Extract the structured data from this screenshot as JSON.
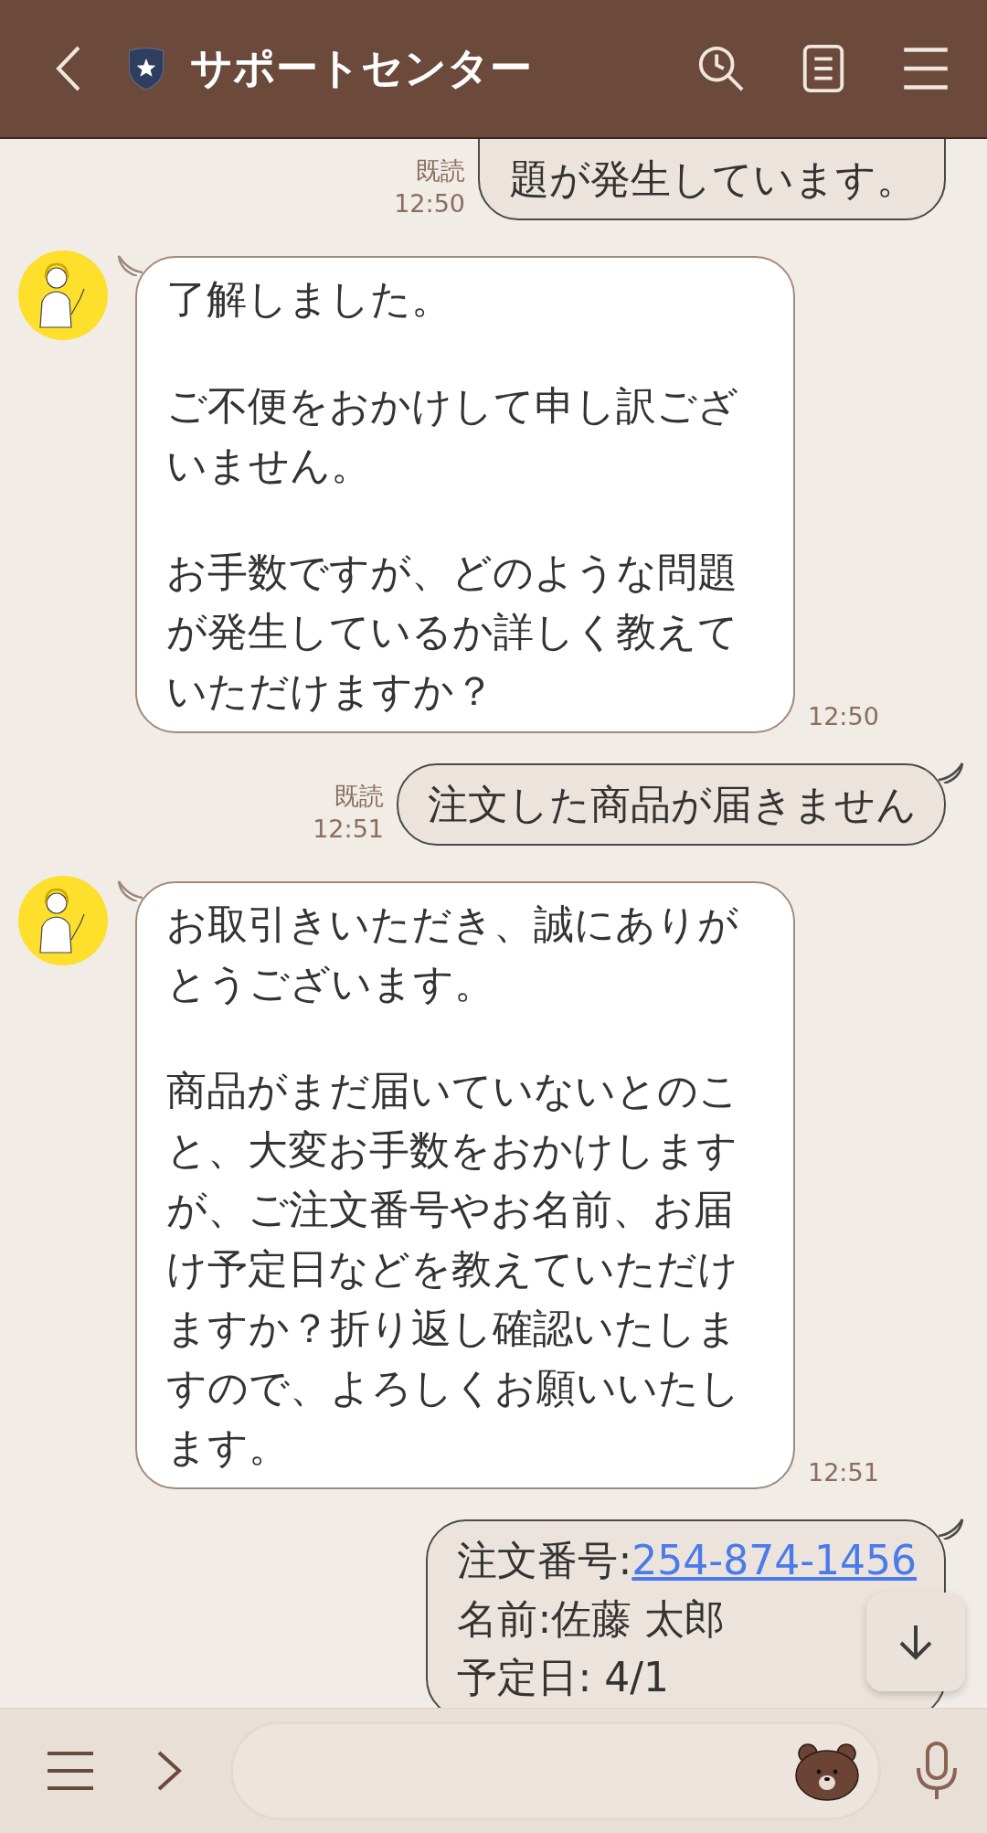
{
  "header": {
    "title": "サポートセンター"
  },
  "messages": [
    {
      "kind": "sent",
      "read": "既読",
      "time": "12:50",
      "lines": [
        {
          "text": "題が発生しています。"
        }
      ]
    },
    {
      "kind": "received",
      "time": "12:50",
      "paragraphs": [
        "了解しました。",
        "ご不便をおかけして申し訳ございません。",
        "お手数ですが、どのような問題が発生しているか詳しく教えていただけますか？"
      ]
    },
    {
      "kind": "sent",
      "read": "既読",
      "time": "12:51",
      "lines": [
        {
          "text": "注文した商品が届きません"
        }
      ]
    },
    {
      "kind": "received",
      "time": "12:51",
      "paragraphs": [
        "お取引きいただき、誠にありがとうございます。",
        "商品がまだ届いていないとのこと、大変お手数をおかけしますが、ご注文番号やお名前、お届け予定日などを教えていただけますか？折り返し確認いたしますので、よろしくお願いいたします。"
      ]
    },
    {
      "kind": "sent",
      "lines": [
        {
          "text": "注文番号:",
          "link": "254-874-1456"
        },
        {
          "text": "名前:佐藤 太郎"
        },
        {
          "text": "予定日: 4/1"
        }
      ]
    }
  ]
}
